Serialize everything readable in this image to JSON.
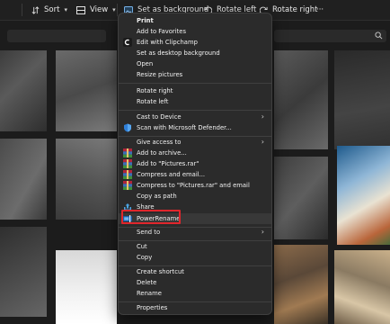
{
  "toolbar": {
    "sort_label": "Sort",
    "view_label": "View",
    "set_background_label": "Set as background",
    "rotate_left_label": "Rotate left",
    "rotate_right_label": "Rotate right",
    "more_label": "···"
  },
  "context_menu": {
    "items": [
      {
        "label": "Print",
        "bold": true
      },
      {
        "label": "Add to Favorites"
      },
      {
        "label": "Edit with Clipchamp",
        "icon": "clipchamp-icon"
      },
      {
        "label": "Set as desktop background"
      },
      {
        "label": "Open"
      },
      {
        "label": "Resize pictures"
      },
      {
        "label": "Rotate right"
      },
      {
        "label": "Rotate left"
      },
      {
        "label": "Cast to Device",
        "submenu": true
      },
      {
        "label": "Scan with Microsoft Defender...",
        "icon": "defender-shield-icon"
      },
      {
        "label": "Give access to",
        "submenu": true
      },
      {
        "label": "Add to archive...",
        "icon": "winrar-icon"
      },
      {
        "label": "Add to \"Pictures.rar\"",
        "icon": "winrar-icon"
      },
      {
        "label": "Compress and email...",
        "icon": "winrar-icon"
      },
      {
        "label": "Compress to \"Pictures.rar\" and email",
        "icon": "winrar-icon"
      },
      {
        "label": "Copy as path"
      },
      {
        "label": "Share",
        "icon": "share-icon"
      },
      {
        "label": "PowerRename",
        "icon": "powerrename-icon",
        "highlighted": true
      },
      {
        "label": "Send to",
        "submenu": true
      },
      {
        "label": "Cut"
      },
      {
        "label": "Copy"
      },
      {
        "label": "Create shortcut"
      },
      {
        "label": "Delete"
      },
      {
        "label": "Rename"
      },
      {
        "label": "Properties"
      }
    ]
  },
  "colors": {
    "highlight_border": "#e0262c",
    "menu_bg": "#2b2b2b",
    "window_bg": "#1c1c1c",
    "accent": "#4aa3e0"
  }
}
